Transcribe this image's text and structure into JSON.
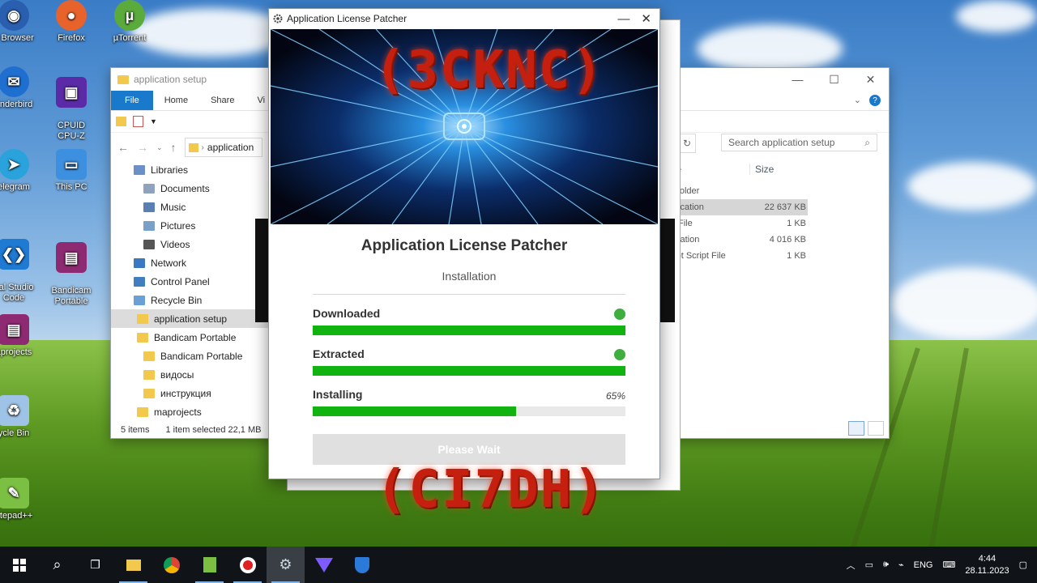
{
  "desktop": {
    "icons": [
      {
        "label": "o Browser"
      },
      {
        "label": "Firefox"
      },
      {
        "label": "µTorrent"
      },
      {
        "label": "underbird"
      },
      {
        "label": "CPUID\nCPU-Z"
      },
      {
        "label": "elegram"
      },
      {
        "label": "This PC"
      },
      {
        "label": "ual Studio\nCode"
      },
      {
        "label": "Bandicam\nPortable"
      },
      {
        "label": "aprojects"
      },
      {
        "label": "ycle Bin"
      },
      {
        "label": "otepad++"
      }
    ]
  },
  "explorer": {
    "title": "application setup",
    "ribbon": {
      "file": "File",
      "home": "Home",
      "share": "Share",
      "view": "Vi"
    },
    "address": "application",
    "search_placeholder": "Search application setup",
    "nav": [
      {
        "label": "Libraries",
        "indent": 0,
        "color": "#6b8fc7"
      },
      {
        "label": "Documents",
        "indent": 1,
        "color": "#8fa3bf"
      },
      {
        "label": "Music",
        "indent": 1,
        "color": "#5a7fb3"
      },
      {
        "label": "Pictures",
        "indent": 1,
        "color": "#7aa0c9"
      },
      {
        "label": "Videos",
        "indent": 1,
        "color": "#555"
      },
      {
        "label": "Network",
        "indent": 0,
        "color": "#3b78c2"
      },
      {
        "label": "Control Panel",
        "indent": 0,
        "color": "#3f7fbf"
      },
      {
        "label": "Recycle Bin",
        "indent": 0,
        "color": "#6aa0d6"
      },
      {
        "label": "application setup",
        "indent": 0,
        "color": "#f2c94c",
        "selected": true
      },
      {
        "label": "Bandicam Portable",
        "indent": 0,
        "color": "#f2c94c"
      },
      {
        "label": "Bandicam Portable",
        "indent": 1,
        "color": "#f2c94c"
      },
      {
        "label": "видосы",
        "indent": 1,
        "color": "#f2c94c"
      },
      {
        "label": "инструкция",
        "indent": 1,
        "color": "#f2c94c"
      },
      {
        "label": "maprojects",
        "indent": 0,
        "color": "#f2c94c"
      }
    ],
    "columns": {
      "type": "Type",
      "size": "Size"
    },
    "rows": [
      {
        "type": "File folder",
        "size": ""
      },
      {
        "type": "Application",
        "size": "22 637 KB",
        "selected": true
      },
      {
        "type": "File",
        "size": "1 KB"
      },
      {
        "type": "plication",
        "size": "4 016 KB"
      },
      {
        "type": "cript Script File",
        "size": "1 KB"
      }
    ],
    "status": {
      "count": "5 items",
      "selection": "1 item selected  22,1 MB"
    }
  },
  "patcher": {
    "window_title": "Application License Patcher",
    "heading": "Application License Patcher",
    "subheading": "Installation",
    "steps": [
      {
        "label": "Downloaded",
        "progress": 100,
        "done": true,
        "pct_text": ""
      },
      {
        "label": "Extracted",
        "progress": 100,
        "done": true,
        "pct_text": ""
      },
      {
        "label": "Installing",
        "progress": 65,
        "done": false,
        "pct_text": "65%"
      }
    ],
    "button_label": "Please Wait"
  },
  "watermarks": {
    "top": "(3CKNC)",
    "bottom": "(CI7DH)"
  },
  "taskbar": {
    "language": "ENG",
    "time": "4:44",
    "date": "28.11.2023"
  },
  "colors": {
    "progress": "#10b310",
    "accent": "#1979ca",
    "stamp": "#c41f0f"
  }
}
